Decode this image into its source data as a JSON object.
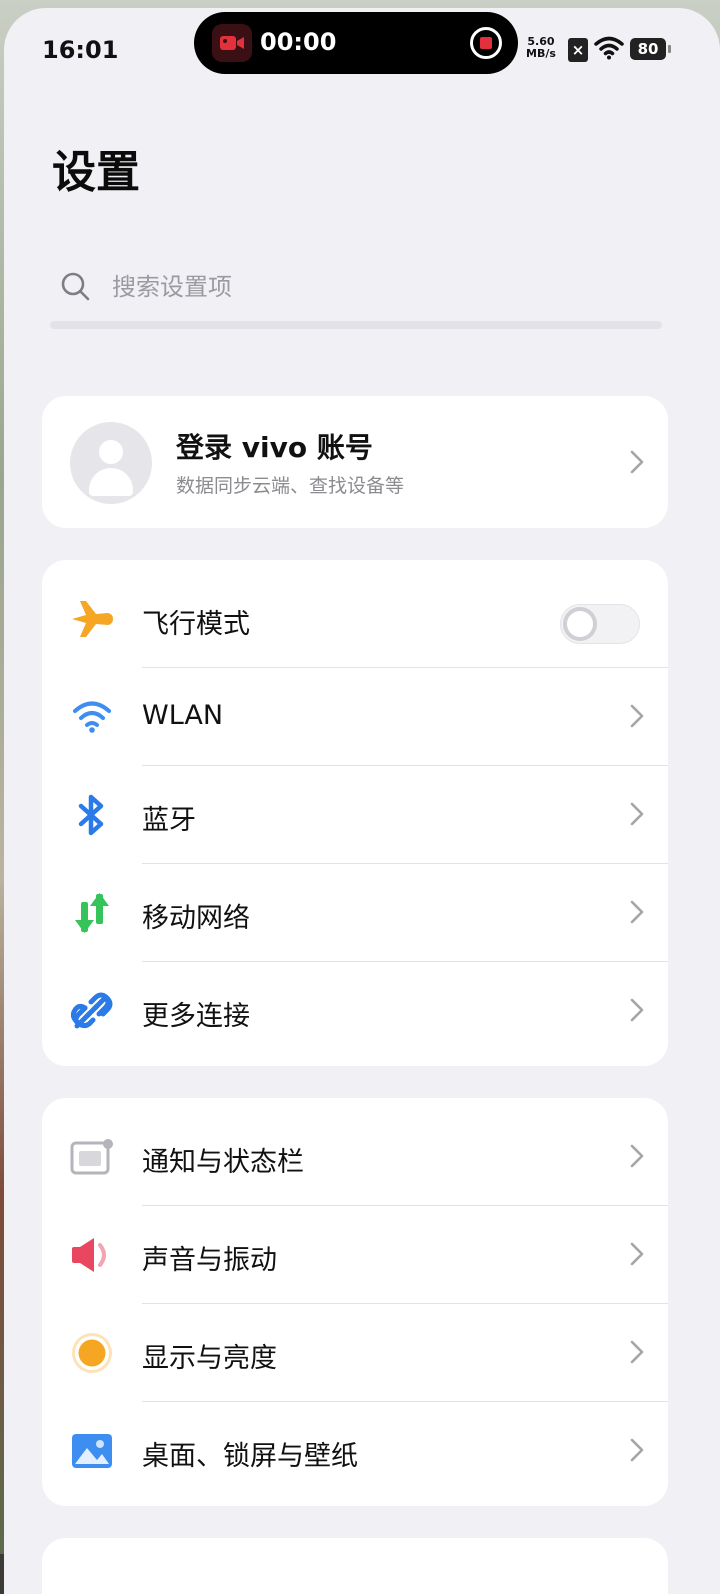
{
  "status": {
    "time": "16:01",
    "recording_time": "00:00",
    "net_speed_value": "5.60",
    "net_speed_unit": "MB/s",
    "battery": "80"
  },
  "page": {
    "title": "设置"
  },
  "search": {
    "placeholder": "搜索设置项"
  },
  "account": {
    "title": "登录 vivo 账号",
    "subtitle": "数据同步云端、查找设备等"
  },
  "connectivity": [
    {
      "label": "飞行模式",
      "icon": "airplane-icon",
      "color": "#f5a623",
      "toggle": false
    },
    {
      "label": "WLAN",
      "icon": "wifi-icon",
      "color": "#3d8ef0"
    },
    {
      "label": "蓝牙",
      "icon": "bluetooth-icon",
      "color": "#2a7ae8"
    },
    {
      "label": "移动网络",
      "icon": "mobile-data-icon",
      "color": "#35c45a"
    },
    {
      "label": "更多连接",
      "icon": "link-icon",
      "color": "#2a7ae8"
    }
  ],
  "system": [
    {
      "label": "通知与状态栏",
      "icon": "notification-icon",
      "color": "#9e9ea4"
    },
    {
      "label": "声音与振动",
      "icon": "sound-icon",
      "color": "#e8475f"
    },
    {
      "label": "显示与亮度",
      "icon": "brightness-icon",
      "color": "#f5a623"
    },
    {
      "label": "桌面、锁屏与壁纸",
      "icon": "wallpaper-icon",
      "color": "#3d8ef0"
    }
  ]
}
